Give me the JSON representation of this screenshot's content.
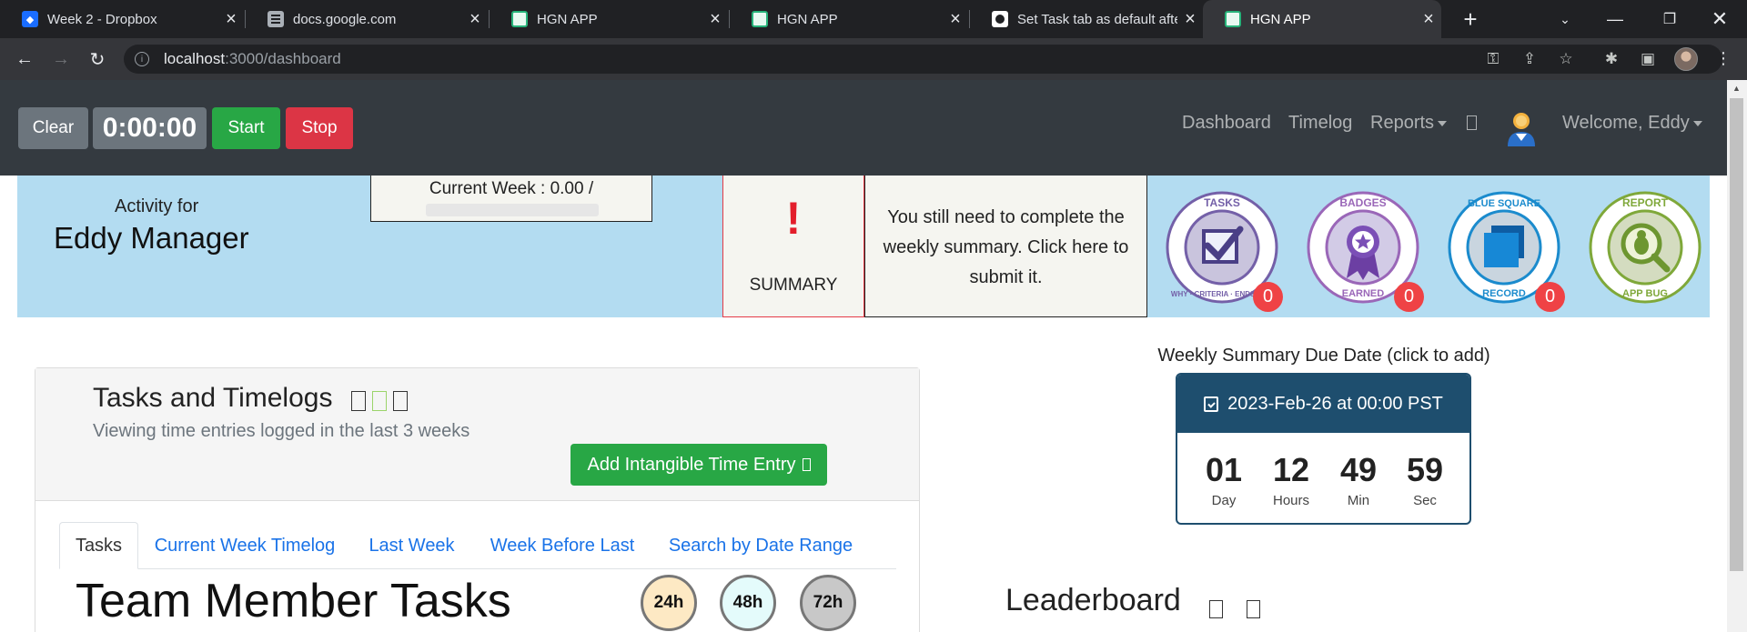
{
  "browser": {
    "tabs": [
      {
        "title": "Week 2 - Dropbox",
        "favicon": "dropbox"
      },
      {
        "title": "docs.google.com",
        "favicon": "docs"
      },
      {
        "title": "HGN APP",
        "favicon": "hgn"
      },
      {
        "title": "HGN APP",
        "favicon": "hgn"
      },
      {
        "title": "Set Task tab as default after",
        "favicon": "github"
      },
      {
        "title": "HGN APP",
        "favicon": "hgn"
      }
    ],
    "active_tab": 5,
    "url_host": "localhost",
    "url_path": ":3000/dashboard"
  },
  "timer": {
    "clear_label": "Clear",
    "time": "0:00:00",
    "start_label": "Start",
    "stop_label": "Stop"
  },
  "nav": {
    "dashboard": "Dashboard",
    "timelog": "Timelog",
    "reports": "Reports",
    "welcome": "Welcome, Eddy"
  },
  "banner": {
    "activity_for": "Activity for",
    "user_name": "Eddy Manager",
    "current_week": "Current Week : 0.00 /",
    "summary_mark": "!",
    "summary_label": "SUMMARY",
    "notice": "You still need to complete the weekly summary. Click here to submit it.",
    "badges": [
      {
        "name": "tasks",
        "top_text": "TASKS",
        "bottom_text": "WHY · CRITERIA · ENDSTATE",
        "count": "0",
        "color": "#7460a8"
      },
      {
        "name": "badges",
        "top_text": "BADGES",
        "bottom_text": "EARNED",
        "count": "0",
        "color": "#9a67b8"
      },
      {
        "name": "blue-square",
        "top_text": "BLUE SQUARE",
        "bottom_text": "RECORD",
        "count": "0",
        "color": "#1b8bcd"
      },
      {
        "name": "report-bug",
        "top_text": "REPORT",
        "bottom_text": "APP BUG",
        "count": "",
        "color": "#7fa83a"
      }
    ]
  },
  "tasks": {
    "title": "Tasks and Timelogs",
    "subtitle": "Viewing time entries logged in the last 3 weeks",
    "add_button": "Add Intangible Time Entry",
    "tabs": [
      "Tasks",
      "Current Week Timelog",
      "Last Week",
      "Week Before Last",
      "Search by Date Range"
    ],
    "team_title": "Team Member Tasks",
    "hour_filters": [
      {
        "label": "24h",
        "color": "#fde9c4"
      },
      {
        "label": "48h",
        "color": "#e4fbfb"
      },
      {
        "label": "72h",
        "color": "#c8c8c8"
      }
    ]
  },
  "summary_due": {
    "label": "Weekly Summary Due Date (click to add)",
    "date": "2023-Feb-26 at 00:00 PST",
    "units": [
      {
        "value": "01",
        "unit": "Day"
      },
      {
        "value": "12",
        "unit": "Hours"
      },
      {
        "value": "49",
        "unit": "Min"
      },
      {
        "value": "59",
        "unit": "Sec"
      }
    ]
  },
  "leaderboard": {
    "title": "Leaderboard"
  },
  "colors": {
    "navbar": "#343a40",
    "banner": "#b3dcf1",
    "success": "#28a745",
    "danger": "#dc3545",
    "countdown": "#1e4e6e",
    "link": "#1a73e8"
  }
}
